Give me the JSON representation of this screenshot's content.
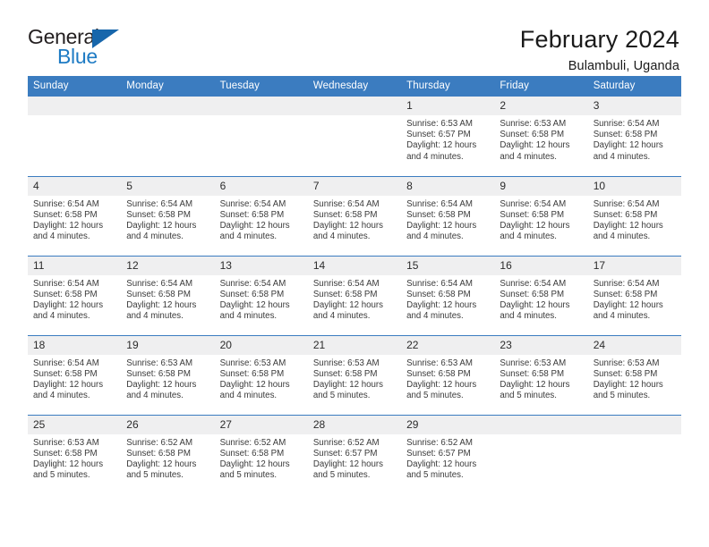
{
  "brand": {
    "name_part1": "General",
    "name_part2": "Blue",
    "triangle_icon": "triangle-logo-mark",
    "accent_color": "#1e7bc4"
  },
  "header": {
    "title": "February 2024",
    "subtitle": "Bulambuli, Uganda"
  },
  "colors": {
    "header_blue": "#3b7cc0",
    "daynum_gray": "#efeff0",
    "text_dark": "#2b2b2b"
  },
  "calendar": {
    "weekday_headers": [
      "Sunday",
      "Monday",
      "Tuesday",
      "Wednesday",
      "Thursday",
      "Friday",
      "Saturday"
    ],
    "weeks": [
      [
        {
          "day": "",
          "blank": true
        },
        {
          "day": "",
          "blank": true
        },
        {
          "day": "",
          "blank": true
        },
        {
          "day": "",
          "blank": true
        },
        {
          "day": "1",
          "sunrise": "Sunrise: 6:53 AM",
          "sunset": "Sunset: 6:57 PM",
          "daylight_line1": "Daylight: 12 hours",
          "daylight_line2": "and 4 minutes."
        },
        {
          "day": "2",
          "sunrise": "Sunrise: 6:53 AM",
          "sunset": "Sunset: 6:58 PM",
          "daylight_line1": "Daylight: 12 hours",
          "daylight_line2": "and 4 minutes."
        },
        {
          "day": "3",
          "sunrise": "Sunrise: 6:54 AM",
          "sunset": "Sunset: 6:58 PM",
          "daylight_line1": "Daylight: 12 hours",
          "daylight_line2": "and 4 minutes."
        }
      ],
      [
        {
          "day": "4",
          "sunrise": "Sunrise: 6:54 AM",
          "sunset": "Sunset: 6:58 PM",
          "daylight_line1": "Daylight: 12 hours",
          "daylight_line2": "and 4 minutes."
        },
        {
          "day": "5",
          "sunrise": "Sunrise: 6:54 AM",
          "sunset": "Sunset: 6:58 PM",
          "daylight_line1": "Daylight: 12 hours",
          "daylight_line2": "and 4 minutes."
        },
        {
          "day": "6",
          "sunrise": "Sunrise: 6:54 AM",
          "sunset": "Sunset: 6:58 PM",
          "daylight_line1": "Daylight: 12 hours",
          "daylight_line2": "and 4 minutes."
        },
        {
          "day": "7",
          "sunrise": "Sunrise: 6:54 AM",
          "sunset": "Sunset: 6:58 PM",
          "daylight_line1": "Daylight: 12 hours",
          "daylight_line2": "and 4 minutes."
        },
        {
          "day": "8",
          "sunrise": "Sunrise: 6:54 AM",
          "sunset": "Sunset: 6:58 PM",
          "daylight_line1": "Daylight: 12 hours",
          "daylight_line2": "and 4 minutes."
        },
        {
          "day": "9",
          "sunrise": "Sunrise: 6:54 AM",
          "sunset": "Sunset: 6:58 PM",
          "daylight_line1": "Daylight: 12 hours",
          "daylight_line2": "and 4 minutes."
        },
        {
          "day": "10",
          "sunrise": "Sunrise: 6:54 AM",
          "sunset": "Sunset: 6:58 PM",
          "daylight_line1": "Daylight: 12 hours",
          "daylight_line2": "and 4 minutes."
        }
      ],
      [
        {
          "day": "11",
          "sunrise": "Sunrise: 6:54 AM",
          "sunset": "Sunset: 6:58 PM",
          "daylight_line1": "Daylight: 12 hours",
          "daylight_line2": "and 4 minutes."
        },
        {
          "day": "12",
          "sunrise": "Sunrise: 6:54 AM",
          "sunset": "Sunset: 6:58 PM",
          "daylight_line1": "Daylight: 12 hours",
          "daylight_line2": "and 4 minutes."
        },
        {
          "day": "13",
          "sunrise": "Sunrise: 6:54 AM",
          "sunset": "Sunset: 6:58 PM",
          "daylight_line1": "Daylight: 12 hours",
          "daylight_line2": "and 4 minutes."
        },
        {
          "day": "14",
          "sunrise": "Sunrise: 6:54 AM",
          "sunset": "Sunset: 6:58 PM",
          "daylight_line1": "Daylight: 12 hours",
          "daylight_line2": "and 4 minutes."
        },
        {
          "day": "15",
          "sunrise": "Sunrise: 6:54 AM",
          "sunset": "Sunset: 6:58 PM",
          "daylight_line1": "Daylight: 12 hours",
          "daylight_line2": "and 4 minutes."
        },
        {
          "day": "16",
          "sunrise": "Sunrise: 6:54 AM",
          "sunset": "Sunset: 6:58 PM",
          "daylight_line1": "Daylight: 12 hours",
          "daylight_line2": "and 4 minutes."
        },
        {
          "day": "17",
          "sunrise": "Sunrise: 6:54 AM",
          "sunset": "Sunset: 6:58 PM",
          "daylight_line1": "Daylight: 12 hours",
          "daylight_line2": "and 4 minutes."
        }
      ],
      [
        {
          "day": "18",
          "sunrise": "Sunrise: 6:54 AM",
          "sunset": "Sunset: 6:58 PM",
          "daylight_line1": "Daylight: 12 hours",
          "daylight_line2": "and 4 minutes."
        },
        {
          "day": "19",
          "sunrise": "Sunrise: 6:53 AM",
          "sunset": "Sunset: 6:58 PM",
          "daylight_line1": "Daylight: 12 hours",
          "daylight_line2": "and 4 minutes."
        },
        {
          "day": "20",
          "sunrise": "Sunrise: 6:53 AM",
          "sunset": "Sunset: 6:58 PM",
          "daylight_line1": "Daylight: 12 hours",
          "daylight_line2": "and 4 minutes."
        },
        {
          "day": "21",
          "sunrise": "Sunrise: 6:53 AM",
          "sunset": "Sunset: 6:58 PM",
          "daylight_line1": "Daylight: 12 hours",
          "daylight_line2": "and 5 minutes."
        },
        {
          "day": "22",
          "sunrise": "Sunrise: 6:53 AM",
          "sunset": "Sunset: 6:58 PM",
          "daylight_line1": "Daylight: 12 hours",
          "daylight_line2": "and 5 minutes."
        },
        {
          "day": "23",
          "sunrise": "Sunrise: 6:53 AM",
          "sunset": "Sunset: 6:58 PM",
          "daylight_line1": "Daylight: 12 hours",
          "daylight_line2": "and 5 minutes."
        },
        {
          "day": "24",
          "sunrise": "Sunrise: 6:53 AM",
          "sunset": "Sunset: 6:58 PM",
          "daylight_line1": "Daylight: 12 hours",
          "daylight_line2": "and 5 minutes."
        }
      ],
      [
        {
          "day": "25",
          "sunrise": "Sunrise: 6:53 AM",
          "sunset": "Sunset: 6:58 PM",
          "daylight_line1": "Daylight: 12 hours",
          "daylight_line2": "and 5 minutes."
        },
        {
          "day": "26",
          "sunrise": "Sunrise: 6:52 AM",
          "sunset": "Sunset: 6:58 PM",
          "daylight_line1": "Daylight: 12 hours",
          "daylight_line2": "and 5 minutes."
        },
        {
          "day": "27",
          "sunrise": "Sunrise: 6:52 AM",
          "sunset": "Sunset: 6:58 PM",
          "daylight_line1": "Daylight: 12 hours",
          "daylight_line2": "and 5 minutes."
        },
        {
          "day": "28",
          "sunrise": "Sunrise: 6:52 AM",
          "sunset": "Sunset: 6:57 PM",
          "daylight_line1": "Daylight: 12 hours",
          "daylight_line2": "and 5 minutes."
        },
        {
          "day": "29",
          "sunrise": "Sunrise: 6:52 AM",
          "sunset": "Sunset: 6:57 PM",
          "daylight_line1": "Daylight: 12 hours",
          "daylight_line2": "and 5 minutes."
        },
        {
          "day": "",
          "blank": true
        },
        {
          "day": "",
          "blank": true
        }
      ]
    ]
  }
}
